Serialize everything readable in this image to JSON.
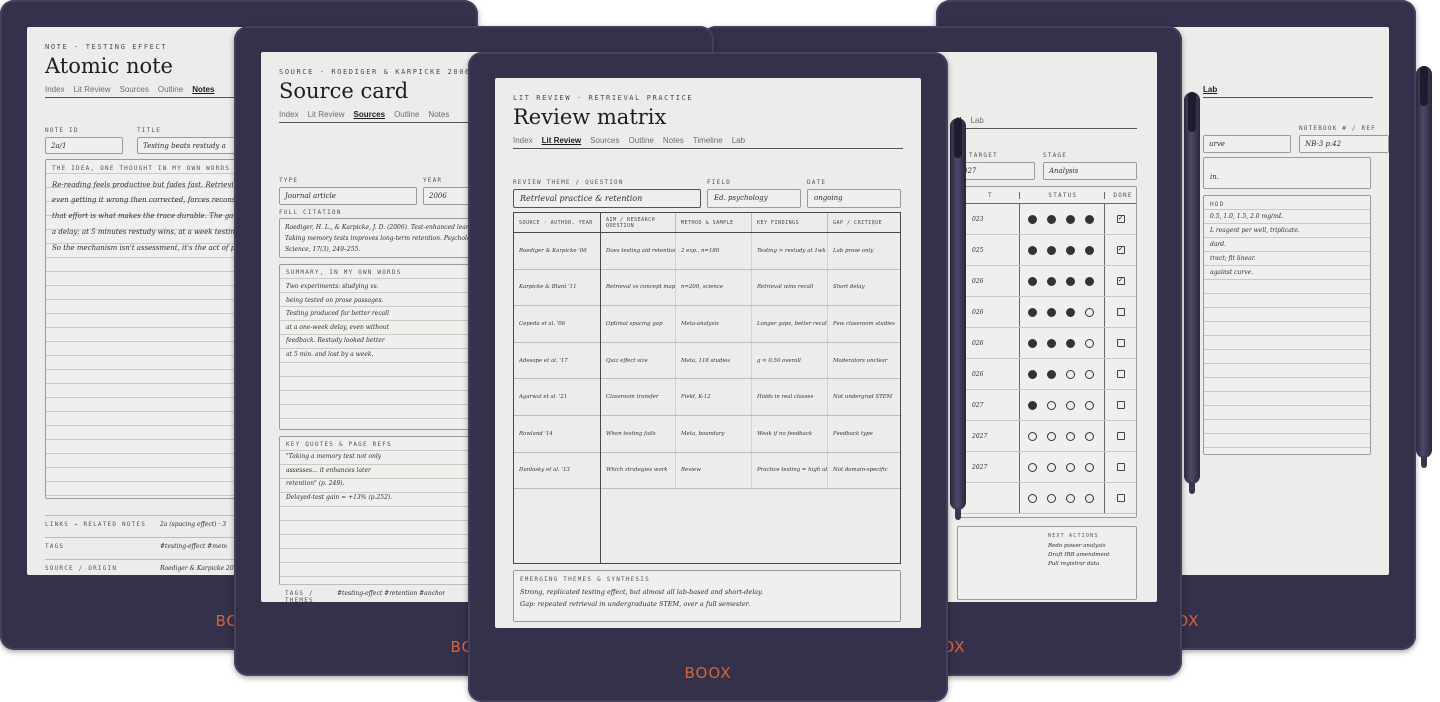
{
  "brand": "BOOX",
  "atomic": {
    "kicker": "NOTE · TESTING EFFECT",
    "title": "Atomic note",
    "tabs": [
      "Index",
      "Lit Review",
      "Sources",
      "Outline",
      "Notes"
    ],
    "active_tab": "Notes",
    "note_id_label": "NOTE ID",
    "note_id": "2a/1",
    "title_label": "TITLE",
    "title_value": "Testing beats restudy a",
    "idea_label": "THE IDEA, ONE THOUGHT IN MY OWN WORDS",
    "idea_lines": [
      "Re-reading feels productive but fades fast. Retrieving the a",
      "even getting it wrong then corrected, forces reconstruction",
      "that effort is what makes the trace durable. The gain only",
      "a delay: at 5 minutes restudy wins, at a week testing wins",
      "So the mechanism isn't assessment, it's the act of pulling i"
    ],
    "links_label": "LINKS → RELATED NOTES",
    "links_value": "2a (spacing effect) · 3",
    "tags_label": "TAGS",
    "tags_value": "#testing-effect  #mem",
    "source_label": "SOURCE / ORIGIN",
    "source_value": "Roediger & Karpicke 20"
  },
  "source": {
    "kicker": "SOURCE · ROEDIGER & KARPICKE 2006",
    "title": "Source card",
    "tabs": [
      "Index",
      "Lit Review",
      "Sources",
      "Outline",
      "Notes"
    ],
    "active_tab": "Sources",
    "type_label": "TYPE",
    "type_value": "Journal article",
    "year_label": "YEAR",
    "year_value": "2006",
    "citation_label": "FULL CITATION",
    "citation_lines": [
      "Roediger, H. L., & Karpicke, J. D. (2006). Test-enhanced learn",
      "Taking memory tests improves long-term retention. Psychologic",
      "Science, 17(3), 249–255."
    ],
    "summary_label": "SUMMARY, IN MY OWN WORDS",
    "summary_lines": [
      "Two experiments: studying vs.",
      "being tested on prose passages.",
      "Testing produced far better recall",
      "at a one-week delay, even without",
      "feedback. Restudy looked better",
      "at 5 min. and lost by a week."
    ],
    "quotes_label": "KEY QUOTES & PAGE REFS",
    "quotes_lines": [
      "\"Taking a memory test not only",
      "assesses... it enhances later",
      "retention\" (p. 249).",
      "Delayed-test gain ≈ +13% (p.252)."
    ],
    "tags_label": "TAGS / THEMES",
    "tags_value": "#testing-effect  #retention  #anchor"
  },
  "review": {
    "kicker": "LIT REVIEW · RETRIEVAL PRACTICE",
    "title": "Review matrix",
    "tabs": [
      "Index",
      "Lit Review",
      "Sources",
      "Outline",
      "Notes",
      "Timeline",
      "Lab"
    ],
    "active_tab": "Lit Review",
    "theme_label": "REVIEW THEME / QUESTION",
    "theme_value": "Retrieval practice & retention",
    "field_label": "FIELD",
    "field_value": "Ed. psychology",
    "date_label": "DATE",
    "date_value": "ongoing",
    "columns": [
      "SOURCE · AUTHOR, YEAR",
      "AIM / RESEARCH QUESTION",
      "METHOD & SAMPLE",
      "KEY FINDINGS",
      "GAP / CRITIQUE"
    ],
    "rows": [
      [
        "Roediger & Karpicke '06",
        "Does testing aid retention?",
        "2 exp., n=180",
        "Testing > restudy at 1wk",
        "Lab prose only"
      ],
      [
        "Karpicke & Blunt '11",
        "Retrieval vs concept maps",
        "n=200, science",
        "Retrieval wins recall",
        "Short delay"
      ],
      [
        "Cepeda et al. '06",
        "Optimal spacing gap",
        "Meta-analysis",
        "Longer gaps, better recall",
        "Few classroom studies"
      ],
      [
        "Adesope et al. '17",
        "Quiz effect size",
        "Meta, 118 studies",
        "g ≈ 0.50 overall",
        "Moderators unclear"
      ],
      [
        "Agarwal et al. '21",
        "Classroom transfer",
        "Field, K-12",
        "Holds in real classes",
        "Not undergrad STEM"
      ],
      [
        "Rowland '14",
        "When testing fails",
        "Meta, boundary",
        "Weak if no feedback",
        "Feedback type"
      ],
      [
        "Dunlosky et al. '13",
        "Which strategies work",
        "Review",
        "Practice testing = high utility",
        "Not domain-specific"
      ]
    ],
    "synthesis_label": "EMERGING THEMES & SYNTHESIS",
    "synthesis_lines": [
      "Strong, replicated testing effect, but almost all lab-based and short-delay.",
      "Gap: repeated retrieval in undergraduate STEM, over a full semester."
    ]
  },
  "status": {
    "tabs": [
      "ll",
      "Lab"
    ],
    "target_label": "TARGET",
    "target_value": "027",
    "stage_label": "STAGE",
    "stage_value": "Analysis",
    "col_t": "T",
    "col_status": "STATUS",
    "col_done": "DONE",
    "rows": [
      {
        "date": "023",
        "dots": [
          1,
          1,
          1,
          1
        ],
        "done": true
      },
      {
        "date": "025",
        "dots": [
          1,
          1,
          1,
          1
        ],
        "done": true
      },
      {
        "date": "026",
        "dots": [
          1,
          1,
          1,
          1
        ],
        "done": true
      },
      {
        "date": "026",
        "dots": [
          1,
          1,
          1,
          0
        ],
        "done": false
      },
      {
        "date": "026",
        "dots": [
          1,
          1,
          1,
          0
        ],
        "done": false
      },
      {
        "date": "026",
        "dots": [
          1,
          1,
          0,
          0
        ],
        "done": false
      },
      {
        "date": "027",
        "dots": [
          1,
          0,
          0,
          0
        ],
        "done": false
      },
      {
        "date": "2027",
        "dots": [
          0,
          0,
          0,
          0
        ],
        "done": false
      },
      {
        "date": "2027",
        "dots": [
          0,
          0,
          0,
          0
        ],
        "done": false
      },
      {
        "date": "",
        "dots": [
          0,
          0,
          0,
          0
        ],
        "done": false
      }
    ],
    "next_label": "NEXT ACTIONS",
    "next_lines": [
      "Redo power analysis",
      "Draft IRB amendment",
      "Pull registrar data"
    ]
  },
  "lab": {
    "tabs": [
      "Lab"
    ],
    "notebook_label": "NOTEBOOK # / REF",
    "notebook_value": "NB-3 p.42",
    "curve_value": "urve",
    "aim_fragment": "in.",
    "method_label": "HOD",
    "method_lines": [
      "0.5, 1.0, 1.5, 2.0 mg/mL",
      "L reagent per well, triplicate.",
      "dard.",
      "tract; fit linear.",
      "against curve."
    ]
  }
}
